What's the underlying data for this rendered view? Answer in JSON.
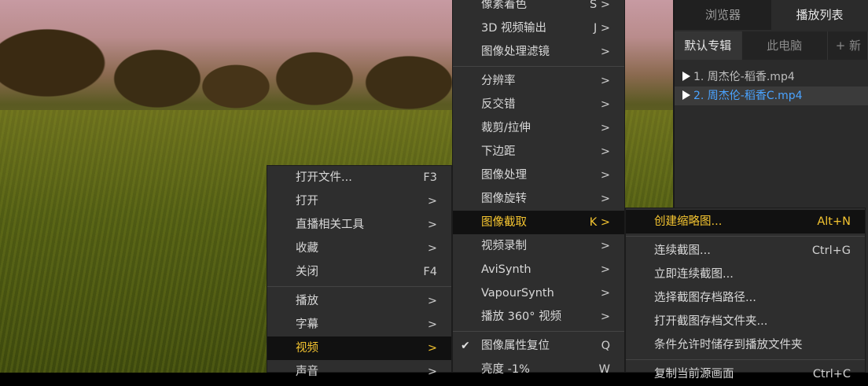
{
  "panel": {
    "tabs": [
      "浏览器",
      "播放列表"
    ],
    "active_tab": 1,
    "subtabs": [
      "默认专辑",
      "此电脑",
      "+ 新建"
    ],
    "playlist": [
      {
        "label": "1. 周杰伦-稻香.mp4",
        "active": false
      },
      {
        "label": "2. 周杰伦-稻香C.mp4",
        "active": true
      }
    ]
  },
  "menu_main": {
    "items": [
      {
        "label": "打开文件...",
        "key": "F3"
      },
      {
        "label": "打开",
        "key": ">"
      },
      {
        "label": "直播相关工具",
        "key": ">"
      },
      {
        "label": "收藏",
        "key": ">"
      },
      {
        "label": "关闭",
        "key": "F4"
      },
      {
        "sep": true
      },
      {
        "label": "播放",
        "key": ">"
      },
      {
        "label": "字幕",
        "key": ">"
      },
      {
        "label": "视频",
        "key": ">",
        "highlight": true
      },
      {
        "label": "声音",
        "key": ">"
      }
    ]
  },
  "menu_video": {
    "items": [
      {
        "label": "像素着色",
        "key": "S >"
      },
      {
        "label": "3D 视频输出",
        "key": "J >"
      },
      {
        "label": "图像处理滤镜",
        "key": ">"
      },
      {
        "sep": true
      },
      {
        "label": "分辨率",
        "key": ">"
      },
      {
        "label": "反交错",
        "key": ">"
      },
      {
        "label": "裁剪/拉伸",
        "key": ">"
      },
      {
        "label": "下边距",
        "key": ">"
      },
      {
        "label": "图像处理",
        "key": ">"
      },
      {
        "label": "图像旋转",
        "key": ">"
      },
      {
        "label": "图像截取",
        "key": "K >",
        "highlight": true
      },
      {
        "label": "视频录制",
        "key": ">"
      },
      {
        "label": "AviSynth",
        "key": ">"
      },
      {
        "label": "VapourSynth",
        "key": ">"
      },
      {
        "label": "播放 360° 视频",
        "key": ">"
      },
      {
        "sep": true
      },
      {
        "label": "图像属性复位",
        "key": "Q",
        "checked": true
      },
      {
        "label": "亮度 -1%",
        "key": "W"
      }
    ]
  },
  "menu_capture": {
    "items": [
      {
        "label": "创建缩略图...",
        "key": "Alt+N",
        "highlight": true
      },
      {
        "sep": true
      },
      {
        "label": "连续截图...",
        "key": "Ctrl+G"
      },
      {
        "label": "立即连续截图...",
        "key": ""
      },
      {
        "label": "选择截图存档路径...",
        "key": ""
      },
      {
        "label": "打开截图存档文件夹...",
        "key": ""
      },
      {
        "label": "条件允许时储存到播放文件夹",
        "key": ""
      },
      {
        "sep": true
      },
      {
        "label": "复制当前源画面",
        "key": "Ctrl+C"
      }
    ]
  }
}
